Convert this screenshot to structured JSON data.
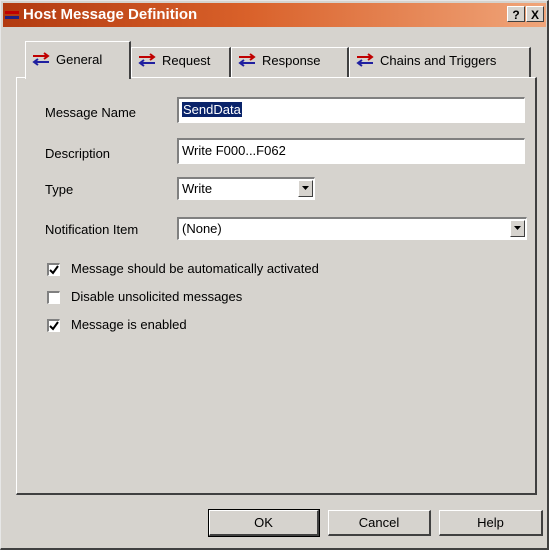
{
  "window": {
    "title": "Host Message Definition",
    "help_glyph": "?",
    "close_glyph": "X"
  },
  "tabs": [
    {
      "label": "General",
      "active": true
    },
    {
      "label": "Request",
      "active": false
    },
    {
      "label": "Response",
      "active": false
    },
    {
      "label": "Chains and Triggers",
      "active": false
    }
  ],
  "form": {
    "message_name": {
      "label": "Message Name",
      "value": "SendData"
    },
    "description": {
      "label": "Description",
      "value": "Write F000...F062"
    },
    "type": {
      "label": "Type",
      "value": "Write"
    },
    "notification_item": {
      "label": "Notification Item",
      "value": "(None)"
    }
  },
  "options": [
    {
      "label": "Message should be automatically activated",
      "checked": true
    },
    {
      "label": "Disable unsolicited messages",
      "checked": false
    },
    {
      "label": "Message is enabled",
      "checked": true
    }
  ],
  "buttons": {
    "ok": "OK",
    "cancel": "Cancel",
    "help": "Help"
  },
  "colors": {
    "titlebar_start": "#b23a10",
    "titlebar_end": "#f0a57a",
    "dialog_bg": "#d6d3ce",
    "selection": "#0a246a"
  }
}
